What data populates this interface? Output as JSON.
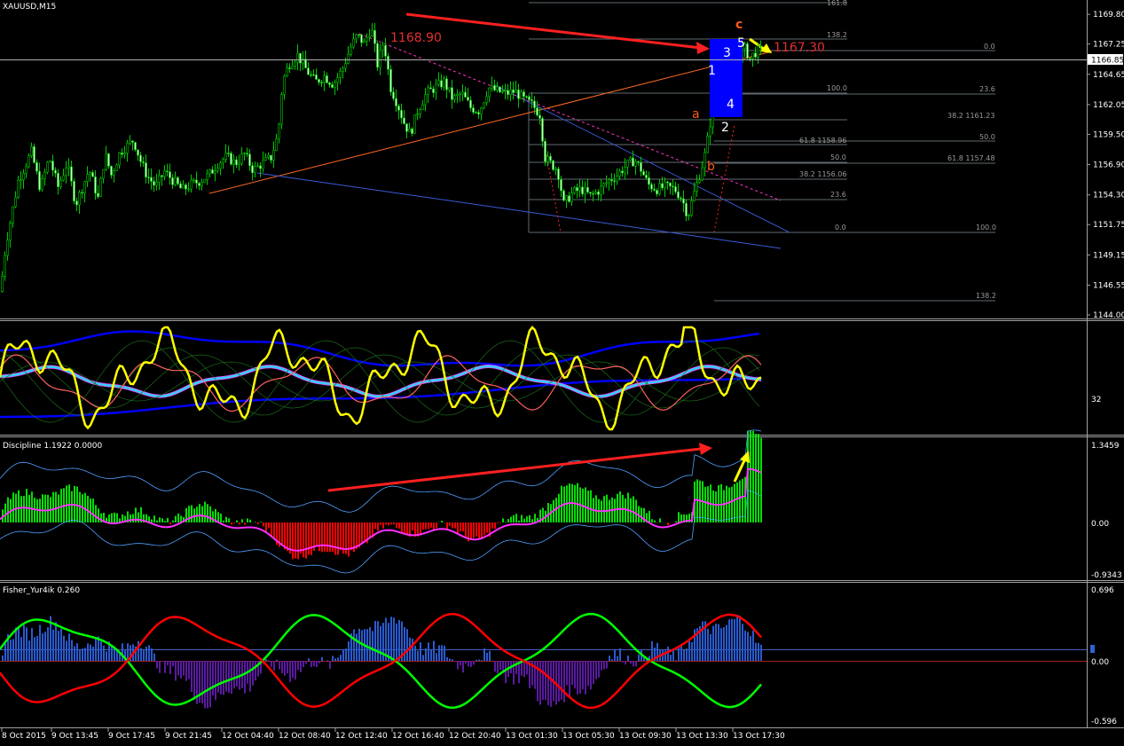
{
  "window": {
    "symbol_title": "XAUUSD,M15"
  },
  "price_pane": {
    "axis_ticks": [
      "1169.80",
      "1167.25",
      "1164.65",
      "1162.05",
      "1159.50",
      "1156.90",
      "1154.30",
      "1151.75",
      "1149.15",
      "1146.55",
      "1144.00"
    ],
    "current_price": "1166.85",
    "annotations": {
      "high_label": "1168.90",
      "target_label": "1167.30"
    },
    "waves": {
      "a": "a",
      "b": "b",
      "c": "c",
      "w1": "1",
      "w2": "2",
      "w3": "3",
      "w4": "4",
      "w5": "5"
    },
    "fib_top": [
      "161.8",
      "138.2",
      "0.0",
      "100.0",
      "23.6",
      "38.2 1161.23",
      "50.0",
      "61.8 1158.96",
      "50.0",
      "61.8 1157.48",
      "38.2 1156.06",
      "23.6",
      "0.0",
      "100.0"
    ],
    "fib_bottom": "138.2"
  },
  "osc1_pane": {
    "axis_tick": "32"
  },
  "discipline_pane": {
    "title": "Discipline 1.1922 0.0000",
    "axis_ticks": [
      "1.3459",
      "0.00",
      "-0.9343"
    ]
  },
  "fisher_pane": {
    "title": "Fisher_Yur4ik 0.260",
    "axis_ticks": [
      "0.696",
      "0.00",
      "-0.596"
    ]
  },
  "time_axis": [
    "8 Oct 2015",
    "9 Oct 13:45",
    "9 Oct 17:45",
    "9 Oct 21:45",
    "12 Oct 04:40",
    "12 Oct 08:40",
    "12 Oct 12:40",
    "12 Oct 16:40",
    "12 Oct 20:40",
    "13 Oct 01:30",
    "13 Oct 05:30",
    "13 Oct 09:30",
    "13 Oct 13:30",
    "13 Oct 17:30"
  ],
  "colors": {
    "bull": "#00e000",
    "bear": "#ff0000",
    "grid": "#606a70",
    "signal": "#ff2020",
    "yellow": "#ffff00",
    "blue_hist": "#2a5ad0",
    "purple_hist": "#5a1aa0",
    "fisher_green": "#00ff00",
    "fisher_red": "#ff0000",
    "wave_orange": "#ff5a1a"
  },
  "chart_data": {
    "type": "candlestick",
    "title": "XAUUSD,M15",
    "x_ticks": [
      "8 Oct 2015",
      "9 Oct 13:45",
      "9 Oct 17:45",
      "9 Oct 21:45",
      "12 Oct 04:40",
      "12 Oct 08:40",
      "12 Oct 12:40",
      "12 Oct 16:40",
      "12 Oct 20:40",
      "13 Oct 01:30",
      "13 Oct 05:30",
      "13 Oct 09:30",
      "13 Oct 13:30",
      "13 Oct 17:30"
    ],
    "ylim": [
      1144.0,
      1170.8
    ],
    "close_path": [
      [
        0,
        1146.0
      ],
      [
        6,
        1150.0
      ],
      [
        20,
        1155.5
      ],
      [
        35,
        1158.0
      ],
      [
        45,
        1154.8
      ],
      [
        55,
        1157.5
      ],
      [
        65,
        1155.0
      ],
      [
        75,
        1157.0
      ],
      [
        85,
        1153.5
      ],
      [
        100,
        1156.5
      ],
      [
        110,
        1154.0
      ],
      [
        118,
        1157.8
      ],
      [
        125,
        1156.0
      ],
      [
        135,
        1158.0
      ],
      [
        150,
        1159.0
      ],
      [
        158,
        1157.2
      ],
      [
        165,
        1156.0
      ],
      [
        175,
        1155.0
      ],
      [
        185,
        1156.3
      ],
      [
        195,
        1155.5
      ],
      [
        205,
        1154.7
      ],
      [
        215,
        1155.2
      ],
      [
        225,
        1155.5
      ],
      [
        235,
        1156.0
      ],
      [
        245,
        1157.0
      ],
      [
        255,
        1157.6
      ],
      [
        265,
        1157.0
      ],
      [
        275,
        1157.8
      ],
      [
        285,
        1156.4
      ],
      [
        295,
        1157.0
      ],
      [
        305,
        1157.5
      ],
      [
        313,
        1159.5
      ],
      [
        318,
        1164.0
      ],
      [
        325,
        1165.5
      ],
      [
        335,
        1166.3
      ],
      [
        345,
        1165.0
      ],
      [
        355,
        1164.0
      ],
      [
        365,
        1164.5
      ],
      [
        375,
        1163.8
      ],
      [
        385,
        1165.0
      ],
      [
        395,
        1167.0
      ],
      [
        402,
        1168.0
      ],
      [
        410,
        1167.3
      ],
      [
        418,
        1168.7
      ],
      [
        425,
        1165.5
      ],
      [
        432,
        1167.5
      ],
      [
        440,
        1163.5
      ],
      [
        448,
        1162.0
      ],
      [
        455,
        1160.5
      ],
      [
        462,
        1159.5
      ],
      [
        470,
        1161.5
      ],
      [
        480,
        1163.0
      ],
      [
        490,
        1163.5
      ],
      [
        500,
        1164.0
      ],
      [
        510,
        1162.5
      ],
      [
        520,
        1163.0
      ],
      [
        530,
        1161.8
      ],
      [
        540,
        1161.5
      ],
      [
        550,
        1163.5
      ],
      [
        560,
        1163.2
      ],
      [
        570,
        1163.0
      ],
      [
        580,
        1163.2
      ],
      [
        590,
        1162.5
      ],
      [
        600,
        1162.0
      ],
      [
        608,
        1161.2
      ],
      [
        614,
        1157.5
      ],
      [
        620,
        1157.0
      ],
      [
        628,
        1156.5
      ],
      [
        635,
        1153.5
      ],
      [
        645,
        1154.5
      ],
      [
        655,
        1154.8
      ],
      [
        665,
        1154.2
      ],
      [
        675,
        1154.7
      ],
      [
        685,
        1155.5
      ],
      [
        695,
        1156.0
      ],
      [
        705,
        1156.8
      ],
      [
        715,
        1157.3
      ],
      [
        722,
        1156.5
      ],
      [
        730,
        1155.2
      ],
      [
        740,
        1154.8
      ],
      [
        750,
        1155.0
      ],
      [
        760,
        1154.8
      ],
      [
        768,
        1154.0
      ],
      [
        775,
        1152.5
      ],
      [
        782,
        1154.5
      ],
      [
        788,
        1156.0
      ],
      [
        795,
        1158.0
      ],
      [
        800,
        1160.5
      ],
      [
        805,
        1163.0
      ],
      [
        810,
        1162.3
      ],
      [
        815,
        1165.5
      ],
      [
        820,
        1163.5
      ],
      [
        825,
        1166.0
      ],
      [
        830,
        1165.5
      ],
      [
        838,
        1167.0
      ],
      [
        845,
        1166.0
      ],
      [
        850,
        1166.5
      ],
      [
        858,
        1166.8
      ]
    ],
    "highs": [
      {
        "label": "1168.90",
        "value": 1168.9
      },
      {
        "label": "1167.30",
        "value": 1167.3
      }
    ],
    "current_price": 1166.85,
    "indicators": [
      {
        "name": "Discipline",
        "ylim": [
          -0.9343,
          1.3459
        ]
      },
      {
        "name": "Fisher_Yur4ik",
        "ylim": [
          -0.596,
          0.696
        ]
      }
    ]
  }
}
